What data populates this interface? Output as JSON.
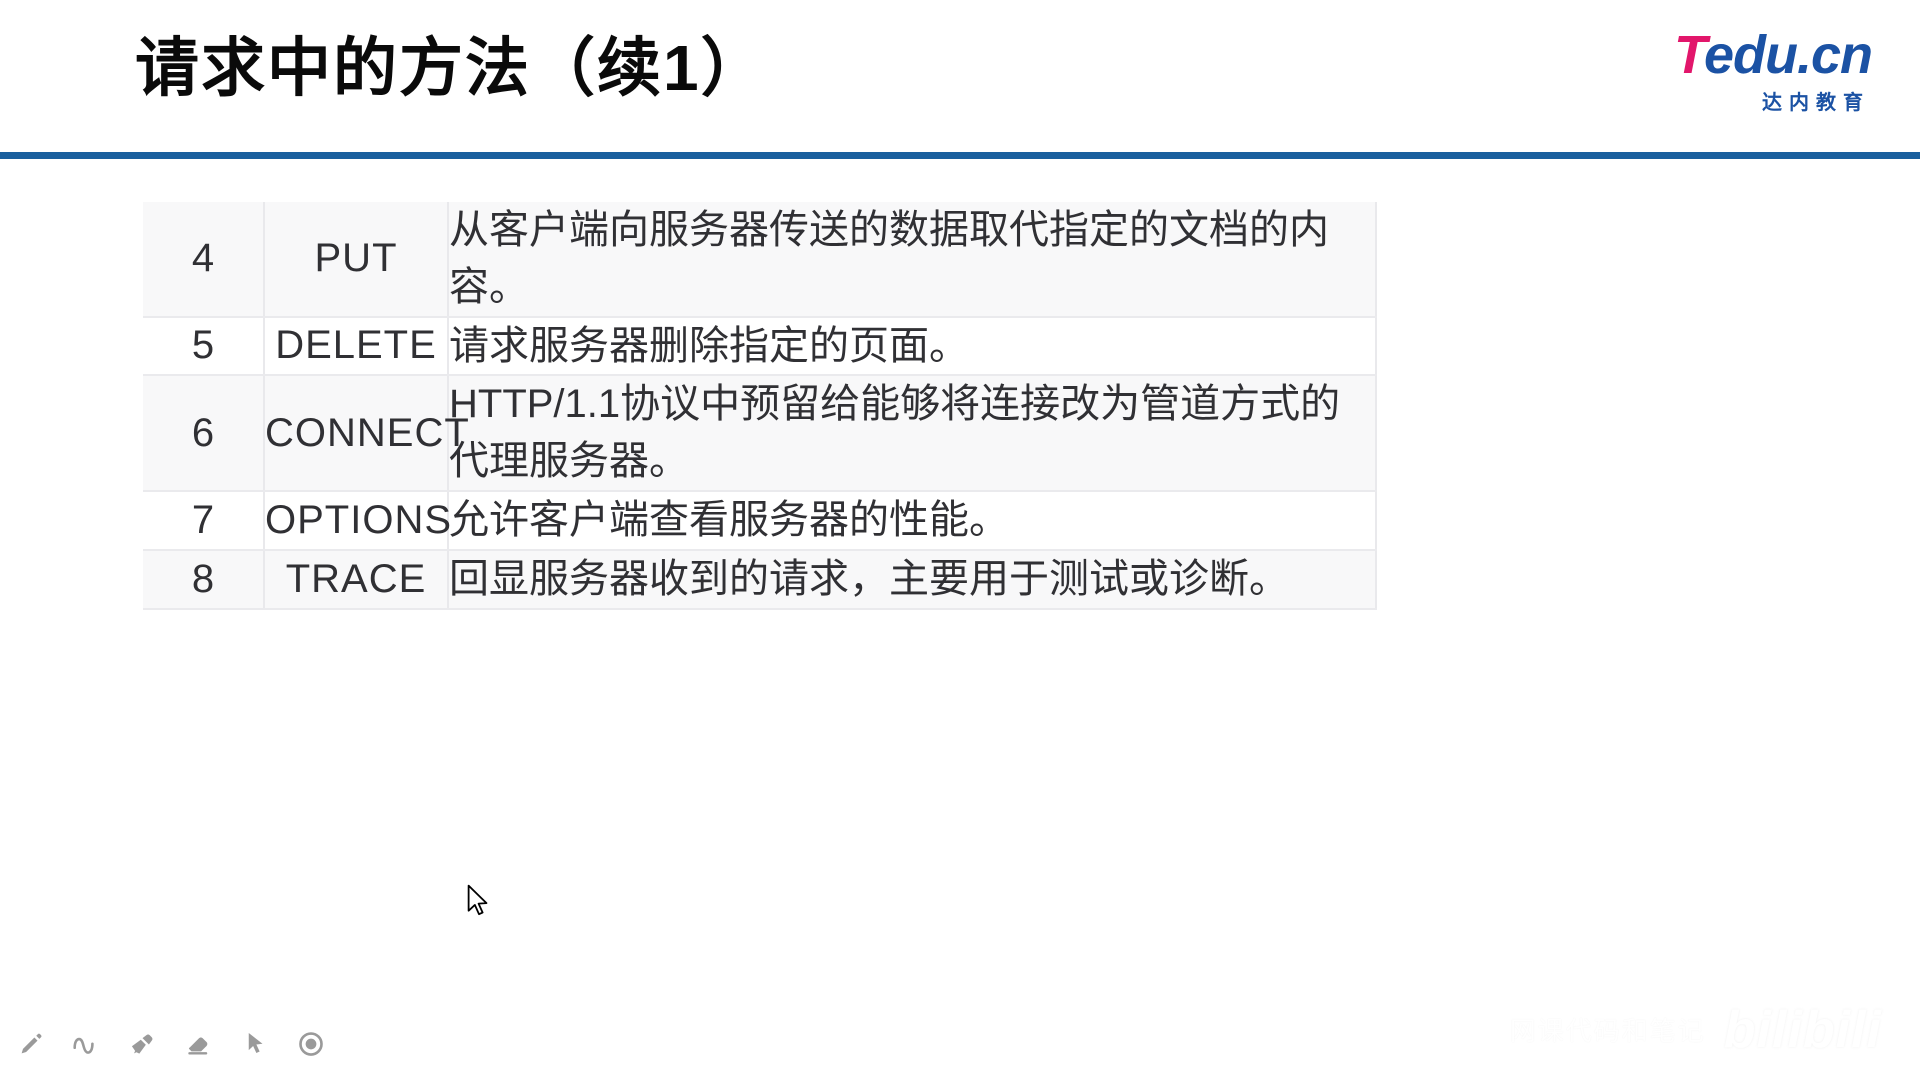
{
  "header": {
    "title": "请求中的方法（续1）",
    "rule_color": "#1a5f9e",
    "logo": {
      "letter_t": "T",
      "word_rest": "edu.cn",
      "subtitle": "达内教育",
      "color_t": "#e2166b",
      "color_rest": "#1b52a4"
    }
  },
  "table": {
    "rows": [
      {
        "num": "4",
        "method": "PUT",
        "desc": "从客户端向服务器传送的数据取代指定的文档的内容。",
        "shaded": true
      },
      {
        "num": "5",
        "method": "DELETE",
        "desc": "请求服务器删除指定的页面。",
        "shaded": false
      },
      {
        "num": "6",
        "method": "CONNECT",
        "desc": "HTTP/1.1协议中预留给能够将连接改为管道方式的代理服务器。",
        "shaded": true
      },
      {
        "num": "7",
        "method": "OPTIONS",
        "desc": "允许客户端查看服务器的性能。",
        "shaded": false
      },
      {
        "num": "8",
        "method": "TRACE",
        "desc": "回显服务器收到的请求，主要用于测试或诊断。",
        "shaded": true
      }
    ]
  },
  "toolbar": {
    "tools": [
      {
        "name": "pen-icon",
        "label": "画笔"
      },
      {
        "name": "squiggle-icon",
        "label": "曲线"
      },
      {
        "name": "highlighter-icon",
        "label": "荧光笔"
      },
      {
        "name": "eraser-icon",
        "label": "橡皮擦"
      },
      {
        "name": "pointer-icon",
        "label": "指针"
      },
      {
        "name": "record-icon",
        "label": "录制"
      }
    ]
  },
  "watermark": {
    "text": "网课代码和笔记",
    "brand": "bilibili"
  }
}
